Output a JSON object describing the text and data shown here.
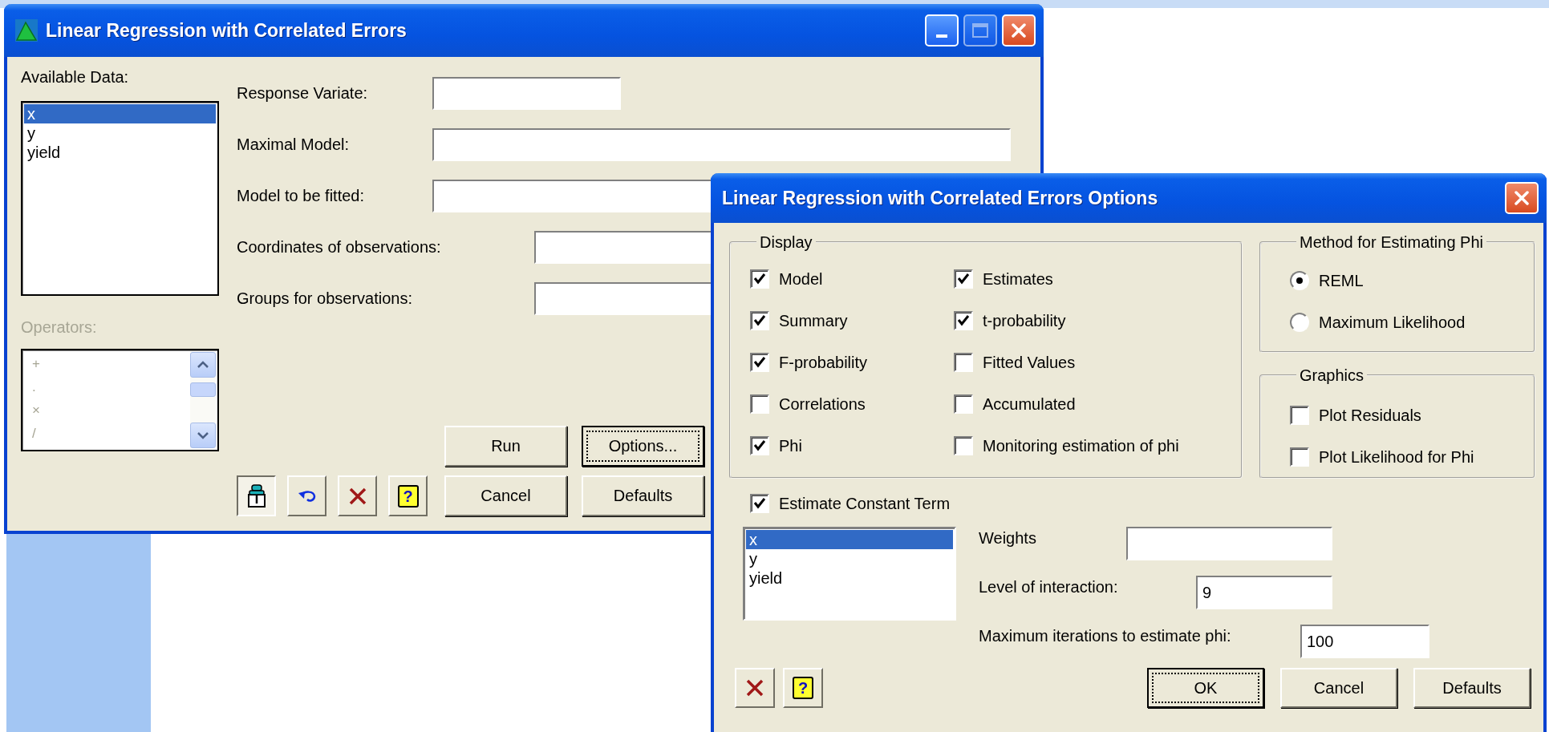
{
  "main_window": {
    "title": "Linear Regression with Correlated Errors",
    "title_buttons": [
      {
        "kind": "minimize",
        "disabled": false
      },
      {
        "kind": "maximize",
        "disabled": true
      },
      {
        "kind": "close",
        "disabled": false
      }
    ],
    "available_data": {
      "label": "Available Data:",
      "items": [
        {
          "text": "x",
          "selected": true
        },
        {
          "text": "y",
          "selected": false
        },
        {
          "text": "yield",
          "selected": false
        }
      ]
    },
    "operators": {
      "label": "Operators:",
      "disabled": true,
      "items": [
        "+",
        ".",
        "×",
        "/"
      ]
    },
    "fields": [
      {
        "label": "Response Variate:"
      },
      {
        "label": "Maximal Model:"
      },
      {
        "label": "Model to be fitted:"
      },
      {
        "label": "Coordinates of observations:"
      },
      {
        "label": "Groups for observations:"
      }
    ],
    "tool_buttons": [
      {
        "kind": "pin",
        "pressed": true
      },
      {
        "kind": "undo",
        "pressed": false
      },
      {
        "kind": "clear",
        "pressed": false
      },
      {
        "kind": "help",
        "label": "?",
        "pressed": false
      }
    ],
    "buttons": [
      {
        "label": "Run",
        "default": false
      },
      {
        "label": "Options...",
        "default": true
      },
      {
        "label": "Cancel",
        "default": false
      },
      {
        "label": "Defaults",
        "default": false
      }
    ]
  },
  "options_dialog": {
    "title": "Linear Regression with Correlated Errors Options",
    "title_buttons": [
      {
        "kind": "close",
        "disabled": false
      }
    ],
    "display": {
      "label": "Display",
      "options": [
        {
          "label": "Model",
          "checked": true
        },
        {
          "label": "Estimates",
          "checked": true
        },
        {
          "label": "Summary",
          "checked": true
        },
        {
          "label": "t-probability",
          "checked": true
        },
        {
          "label": "F-probability",
          "checked": true
        },
        {
          "label": "Fitted Values",
          "checked": false
        },
        {
          "label": "Correlations",
          "checked": false
        },
        {
          "label": "Accumulated",
          "checked": false
        },
        {
          "label": "Phi",
          "checked": true
        },
        {
          "label": "Monitoring estimation of phi",
          "checked": false
        }
      ]
    },
    "method": {
      "label": "Method for Estimating Phi",
      "options": [
        {
          "label": "REML",
          "selected": true
        },
        {
          "label": "Maximum Likelihood",
          "selected": false
        }
      ]
    },
    "graphics": {
      "label": "Graphics",
      "options": [
        {
          "label": "Plot Residuals",
          "checked": false
        },
        {
          "label": "Plot Likelihood for Phi",
          "checked": false
        }
      ]
    },
    "constant_term": {
      "label": "Estimate Constant Term",
      "checked": true
    },
    "data_list": [
      {
        "text": "x",
        "selected": true
      },
      {
        "text": "y",
        "selected": false
      },
      {
        "text": "yield",
        "selected": false
      }
    ],
    "fields": [
      {
        "label": "Weights"
      },
      {
        "label": "Level of interaction:",
        "value": "9"
      },
      {
        "label": "Maximum iterations to estimate phi:",
        "value": "100"
      }
    ],
    "tool_buttons": [
      {
        "kind": "clear",
        "pressed": false
      },
      {
        "kind": "help",
        "label": "?",
        "pressed": false
      }
    ],
    "buttons": [
      {
        "label": "OK",
        "default": true
      },
      {
        "label": "Cancel",
        "default": false
      },
      {
        "label": "Defaults",
        "default": false
      }
    ]
  }
}
